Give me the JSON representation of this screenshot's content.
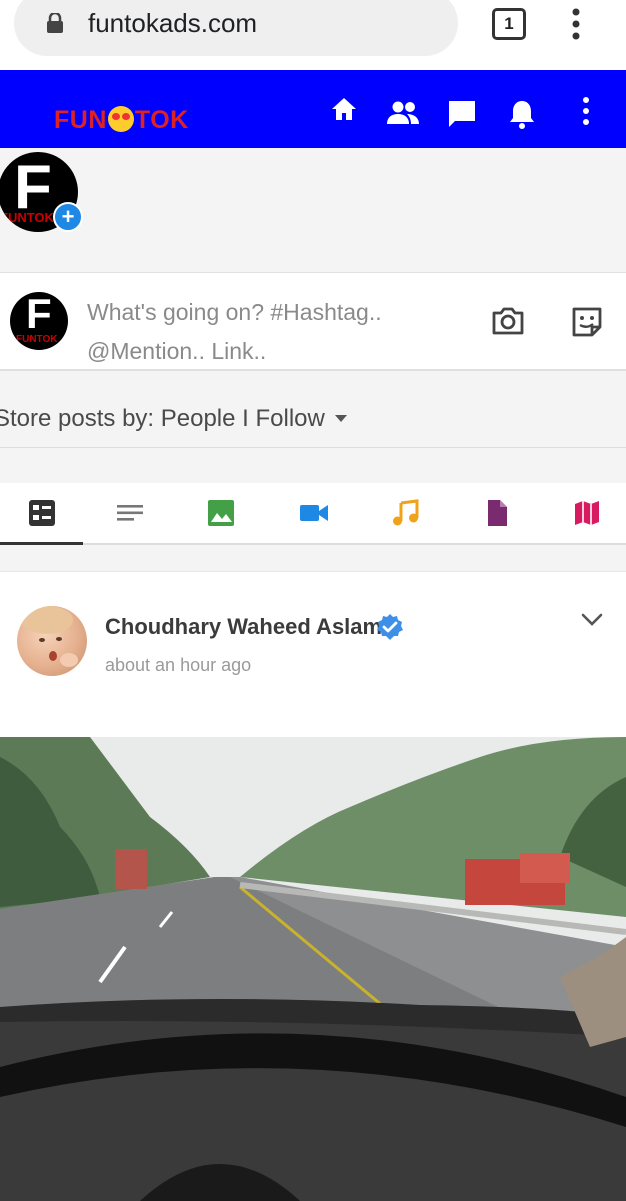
{
  "browser": {
    "url": "funtokads.com",
    "tab_count": "1"
  },
  "app": {
    "logo_text_1": "FUN",
    "logo_text_2": "TOK",
    "header_icons": [
      "home-icon",
      "friends-icon",
      "messages-icon",
      "notifications-icon",
      "more-vert-icon"
    ],
    "header_color": "#0000ff"
  },
  "stories": {
    "my_story_initial": "F",
    "my_story_caption": "FUNTOK"
  },
  "composer": {
    "avatar_initial": "F",
    "avatar_caption": "FUNTOK",
    "placeholder": "What's going on? #Hashtag.. @Mention.. Link.."
  },
  "filter": {
    "label": "Store posts by: People I Follow"
  },
  "type_tabs": [
    "all-posts",
    "text",
    "images",
    "videos",
    "music",
    "files",
    "maps"
  ],
  "post": {
    "author": "Choudhary Waheed Aslam",
    "time": "about an hour ago"
  }
}
